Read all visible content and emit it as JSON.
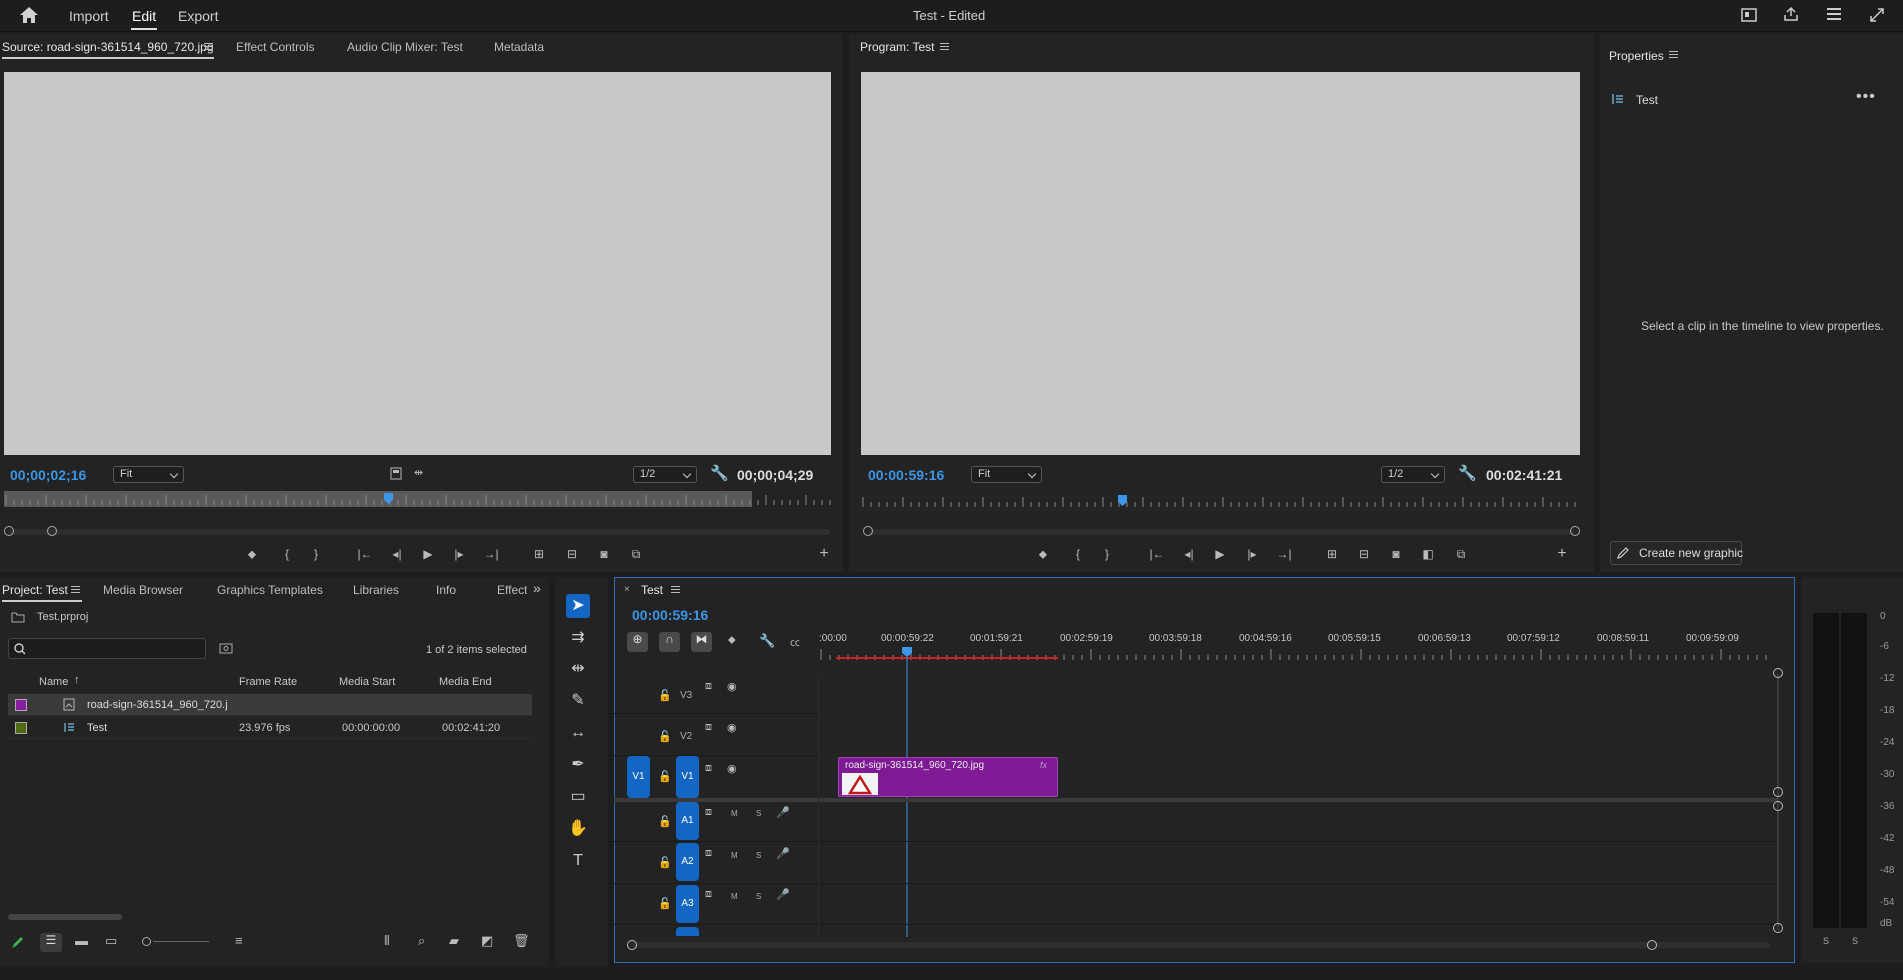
{
  "topbar": {
    "import": "Import",
    "edit": "Edit",
    "export": "Export",
    "title": "Test - Edited"
  },
  "source": {
    "tab_source": "Source: road-sign-361514_960_720.jpg",
    "tab_effect_controls": "Effect Controls",
    "tab_audio_mixer": "Audio Clip Mixer: Test",
    "tab_metadata": "Metadata",
    "timecode": "00;00;02;16",
    "fit": "Fit",
    "res": "1/2",
    "duration": "00;00;04;29"
  },
  "program": {
    "tab": "Program: Test",
    "timecode": "00:00:59:16",
    "fit": "Fit",
    "res": "1/2",
    "duration": "00:02:41:21"
  },
  "properties": {
    "title": "Properties",
    "seq_name": "Test",
    "message": "Select a clip in the timeline to view properties.",
    "create_btn": "Create new graphic"
  },
  "project": {
    "tab_project": "Project: Test",
    "tab_media_browser": "Media Browser",
    "tab_graphics_templates": "Graphics Templates",
    "tab_libraries": "Libraries",
    "tab_info": "Info",
    "tab_effects": "Effects",
    "file": "Test.prproj",
    "search_placeholder": "",
    "selection": "1 of 2 items selected",
    "columns": {
      "name": "Name",
      "frame_rate": "Frame Rate",
      "media_start": "Media Start",
      "media_end": "Media End"
    },
    "items": [
      {
        "name": "road-sign-361514_960_720.j",
        "frame_rate": "",
        "media_start": "",
        "media_end": "",
        "color": "#8a1ea0"
      },
      {
        "name": "Test",
        "frame_rate": "23.976 fps",
        "media_start": "00:00:00:00",
        "media_end": "00:02:41:20",
        "color": "#4f6a12"
      }
    ]
  },
  "timeline": {
    "tab": "Test",
    "timecode": "00:00:59:16",
    "ruler": [
      ":00:00",
      "00:00:59:22",
      "00:01:59:21",
      "00:02:59:19",
      "00:03:59:18",
      "00:04:59:16",
      "00:05:59:15",
      "00:06:59:13",
      "00:07:59:12",
      "00:08:59:11",
      "00:09:59:09"
    ],
    "tracks": {
      "v3": "V3",
      "v2": "V2",
      "v1_src": "V1",
      "v1": "V1",
      "a1": "A1",
      "a2": "A2",
      "a3": "A3",
      "m": "M",
      "s": "S"
    },
    "clip_name": "road-sign-361514_960_720.jpg",
    "fx": "fx"
  },
  "meter": {
    "labels": [
      "0",
      "-6",
      "-12",
      "-18",
      "-24",
      "-30",
      "-36",
      "-42",
      "-48",
      "-54",
      "dB"
    ],
    "solo": "S"
  }
}
